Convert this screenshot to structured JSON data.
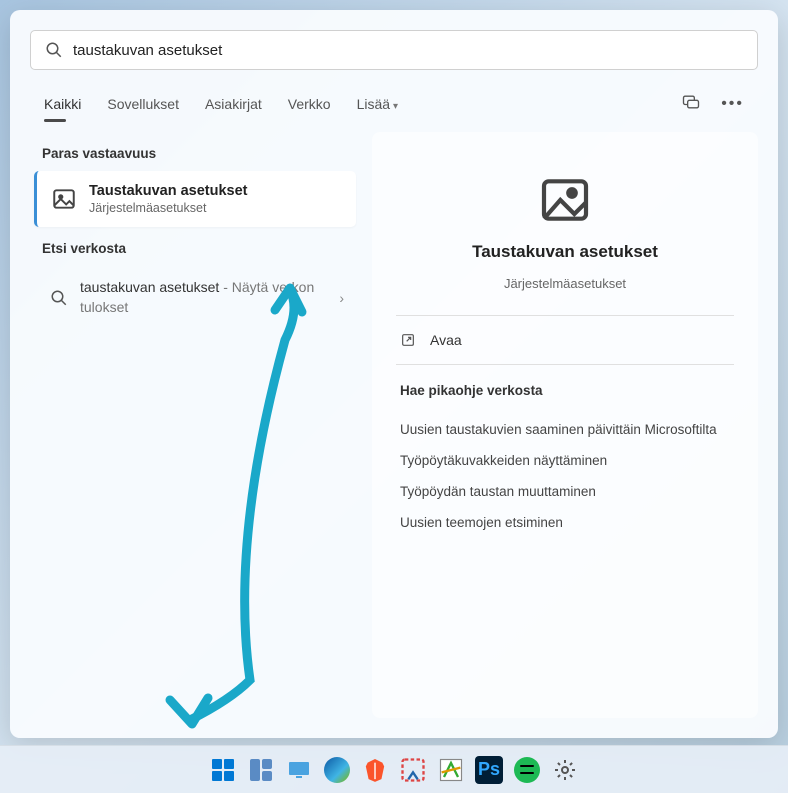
{
  "search": {
    "value": "taustakuvan asetukset"
  },
  "tabs": {
    "all": "Kaikki",
    "apps": "Sovellukset",
    "documents": "Asiakirjat",
    "web": "Verkko",
    "more": "Lisää"
  },
  "left": {
    "best_match_label": "Paras vastaavuus",
    "best_match": {
      "title": "Taustakuvan asetukset",
      "subtitle": "Järjestelmäasetukset"
    },
    "search_web_label": "Etsi verkosta",
    "web_item": {
      "term": "taustakuvan asetukset",
      "suffix": " - Näytä verkon tulokset"
    }
  },
  "preview": {
    "title": "Taustakuvan asetukset",
    "subtitle": "Järjestelmäasetukset",
    "open": "Avaa",
    "quick_help_title": "Hae pikaohje verkosta",
    "links": [
      "Uusien taustakuvien saaminen päivittäin Microsoftilta",
      "Työpöytäkuvakkeiden näyttäminen",
      "Työpöydän taustan muuttaminen",
      "Uusien teemojen etsiminen"
    ]
  }
}
